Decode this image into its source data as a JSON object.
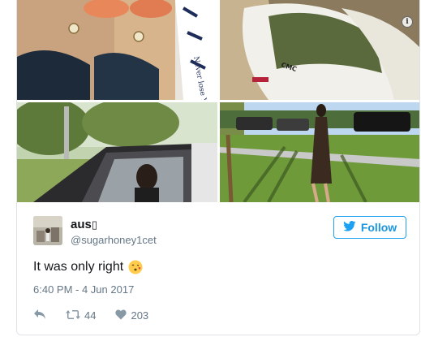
{
  "tweet": {
    "author_name": "aus",
    "author_name_glyph": "▯",
    "handle": "@sugarhoney1cet",
    "follow_label": "Follow",
    "text": "It was only right",
    "timestamp": "6:40 PM - 4 Jun 2017",
    "retweets": "44",
    "likes": "203"
  },
  "media": {
    "shoe_text_1": "CMC",
    "shoe_text_2": "Never lose You",
    "info_icon": "i"
  },
  "icons": {
    "reply": "reply-icon",
    "retweet": "retweet-icon",
    "like": "heart-icon",
    "bird": "twitter-bird-icon",
    "emoji": "kissing-face-emoji",
    "info": "info-icon"
  },
  "colors": {
    "brand": "#1da1f2",
    "text": "#14171a",
    "muted": "#657786",
    "border": "#dfe3e7"
  }
}
